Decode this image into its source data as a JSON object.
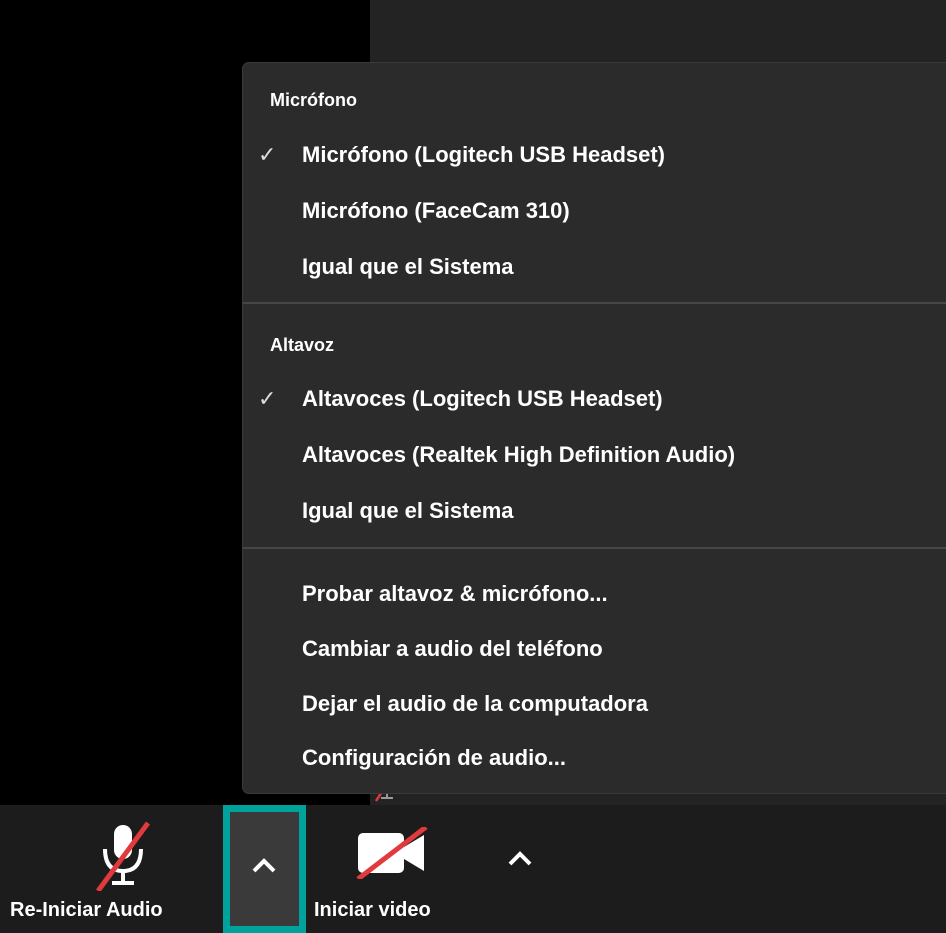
{
  "menu": {
    "mic_header": "Micrófono",
    "mic_items": [
      {
        "label": "Micrófono (Logitech USB Headset)",
        "checked": true
      },
      {
        "label": "Micrófono (FaceCam 310)",
        "checked": false
      },
      {
        "label": "Igual que el Sistema",
        "checked": false
      }
    ],
    "speaker_header": "Altavoz",
    "speaker_items": [
      {
        "label": "Altavoces (Logitech USB Headset)",
        "checked": true
      },
      {
        "label": "Altavoces (Realtek High Definition Audio)",
        "checked": false
      },
      {
        "label": "Igual que el Sistema",
        "checked": false
      }
    ],
    "actions": [
      "Probar altavoz & micrófono...",
      "Cambiar a audio del teléfono",
      "Dejar el audio de la computadora",
      "Configuración de audio..."
    ],
    "check_glyph": "✓"
  },
  "toolbar": {
    "audio_label": "Re-Iniciar Audio",
    "video_label": "Iniciar video",
    "highlight_color": "#00a39b",
    "mute_slash_color": "#e0393e"
  }
}
